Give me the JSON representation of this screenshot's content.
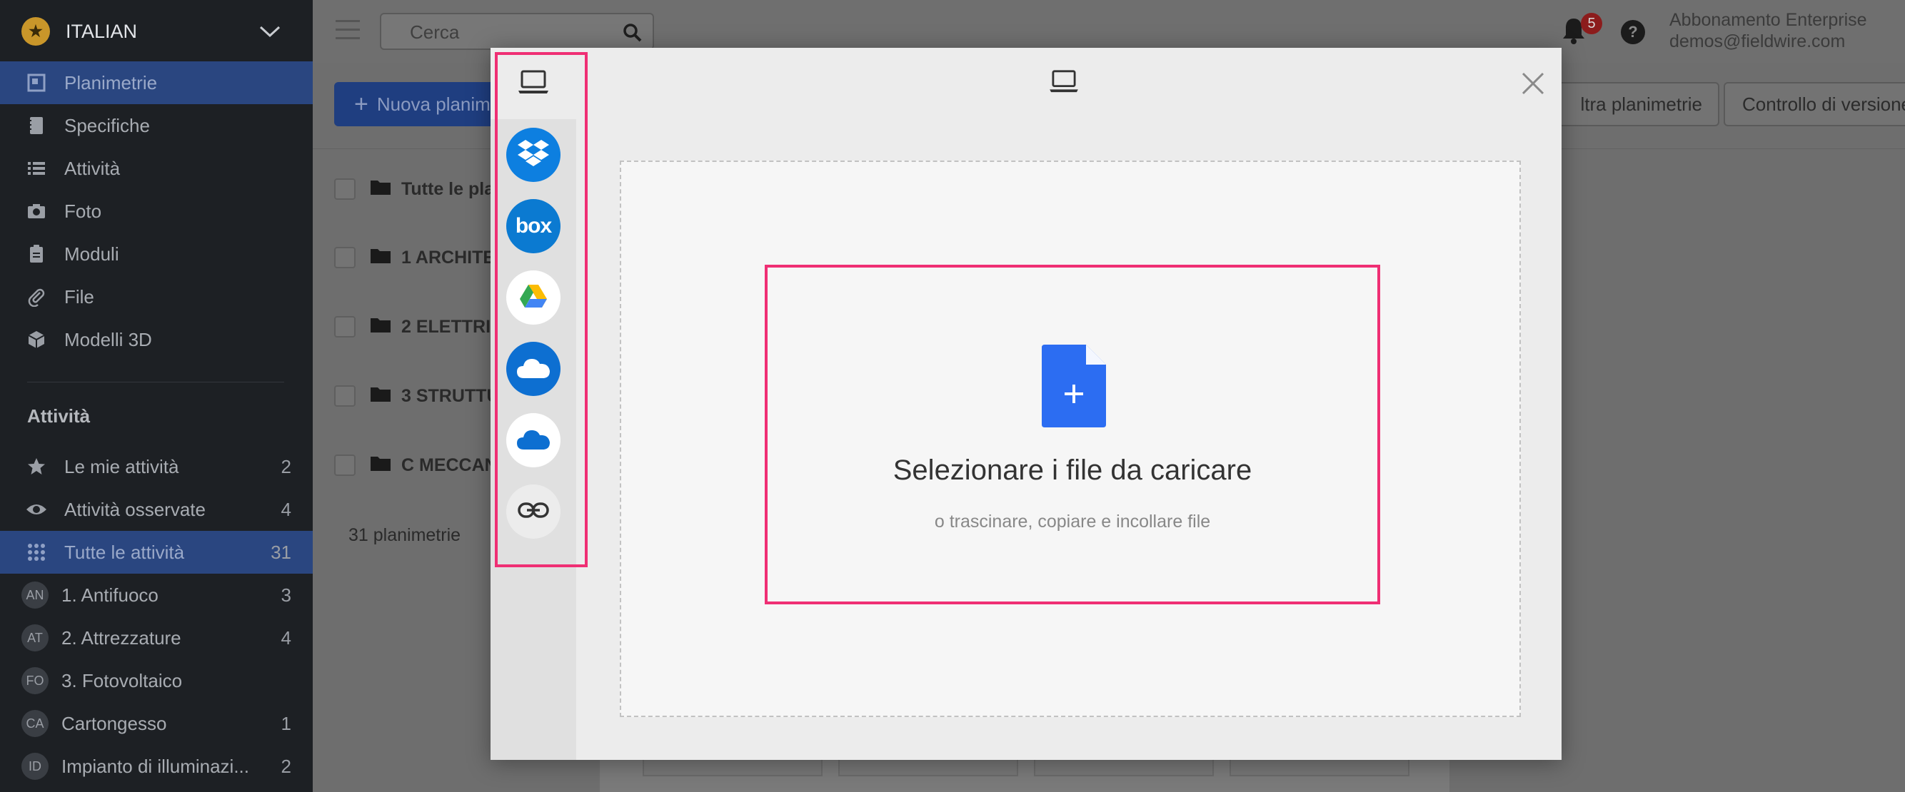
{
  "project": {
    "name": "ITALIAN",
    "logo_glyph": "★"
  },
  "nav": [
    {
      "label": "Planimetrie",
      "icon": "plans-icon",
      "active": true
    },
    {
      "label": "Specifiche",
      "icon": "specs-icon"
    },
    {
      "label": "Attività",
      "icon": "list-icon"
    },
    {
      "label": "Foto",
      "icon": "camera-icon"
    },
    {
      "label": "Moduli",
      "icon": "clipboard-icon"
    },
    {
      "label": "File",
      "icon": "paperclip-icon"
    },
    {
      "label": "Modelli 3D",
      "icon": "cube-icon"
    }
  ],
  "tasks_section": {
    "title": "Attività",
    "items": [
      {
        "label": "Le mie attività",
        "count": "2",
        "icon": "star-icon"
      },
      {
        "label": "Attività osservate",
        "count": "4",
        "icon": "eye-icon"
      },
      {
        "label": "Tutte le attività",
        "count": "31",
        "icon": "grid-icon",
        "active": true
      },
      {
        "label": "1. Antifuoco",
        "count": "3",
        "avatar": "AN"
      },
      {
        "label": "2. Attrezzature",
        "count": "4",
        "avatar": "AT"
      },
      {
        "label": "3. Fotovoltaico",
        "count": "",
        "avatar": "FO"
      },
      {
        "label": "Cartongesso",
        "count": "1",
        "avatar": "CA"
      },
      {
        "label": "Impianto di illuminazi...",
        "count": "2",
        "avatar": "ID"
      }
    ]
  },
  "topbar": {
    "search_placeholder": "Cerca",
    "notification_count": "5",
    "help_label": "?",
    "account_plan": "Abbonamento Enterprise",
    "account_email": "demos@fieldwire.com"
  },
  "main": {
    "new_button": "Nuova planim",
    "new_button_plus": "+",
    "filter_button": "ltra planimetrie",
    "version_button": "Controllo di versione",
    "folders": [
      "Tutte le pla",
      "1 ARCHITE",
      "2 ELETTRIC",
      "3 STRUTTU",
      "C MECCAN"
    ],
    "plan_count": "31 planimetrie"
  },
  "modal": {
    "sources": [
      {
        "name": "my-device-icon"
      },
      {
        "name": "dropbox-icon",
        "color": "#0d7fe0"
      },
      {
        "name": "box-icon",
        "color": "#0b7ad1",
        "text": "box"
      },
      {
        "name": "google-drive-icon",
        "color": "#ffffff"
      },
      {
        "name": "onedrive-icon",
        "color": "#0d6fd1"
      },
      {
        "name": "onedrive-business-icon",
        "color": "#ffffff"
      },
      {
        "name": "link-icon",
        "color": "#ececec"
      }
    ],
    "upload_title": "Selezionare i file da caricare",
    "upload_subtitle": "o trascinare, copiare e incollare file",
    "file_icon_color": "#2c6df2",
    "close_label": "close"
  }
}
